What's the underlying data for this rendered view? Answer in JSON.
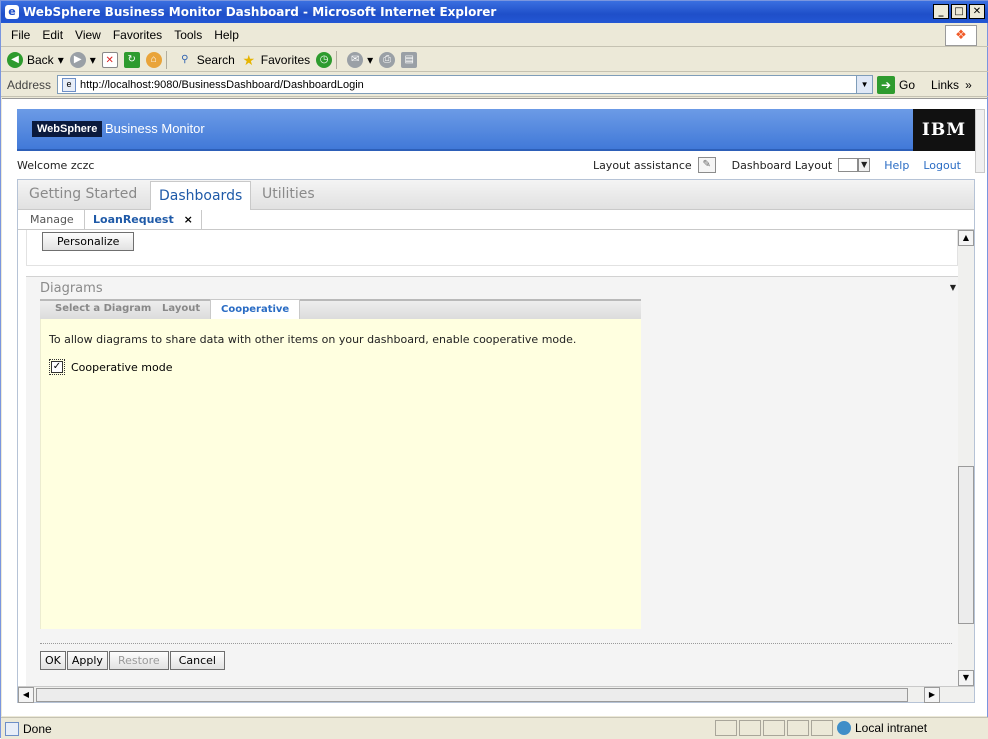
{
  "window": {
    "title": "WebSphere Business Monitor Dashboard - Microsoft Internet Explorer",
    "min": "_",
    "max": "□",
    "close": "✕"
  },
  "menu": [
    "File",
    "Edit",
    "View",
    "Favorites",
    "Tools",
    "Help"
  ],
  "toolbar": {
    "back": "Back",
    "search": "Search",
    "favorites": "Favorites"
  },
  "address": {
    "label": "Address",
    "url": "http://localhost:9080/BusinessDashboard/DashboardLogin",
    "go": "Go",
    "links": "Links"
  },
  "banner": {
    "brand": "WebSphere",
    "product": "Business Monitor",
    "ibm": "IBM"
  },
  "header": {
    "welcome": "Welcome zczc",
    "layout_assistance": "Layout assistance",
    "dashboard_layout": "Dashboard Layout",
    "help": "Help",
    "logout": "Logout"
  },
  "tabs": [
    "Getting Started",
    "Dashboards",
    "Utilities"
  ],
  "subtabs": [
    "Manage",
    "LoanRequest"
  ],
  "subtab_close": "×",
  "personalize": "Personalize",
  "diagrams": {
    "title": "Diagrams",
    "tabs": [
      "Select a Diagram",
      "Layout",
      "Cooperative"
    ],
    "message": "To allow diagrams to share data with other items on your dashboard, enable cooperative mode.",
    "checkbox_label": "Cooperative mode",
    "checkbox_checked": true
  },
  "actions": {
    "ok": "OK",
    "apply": "Apply",
    "restore": "Restore",
    "cancel": "Cancel"
  },
  "status": {
    "text": "Done",
    "zone": "Local intranet"
  }
}
